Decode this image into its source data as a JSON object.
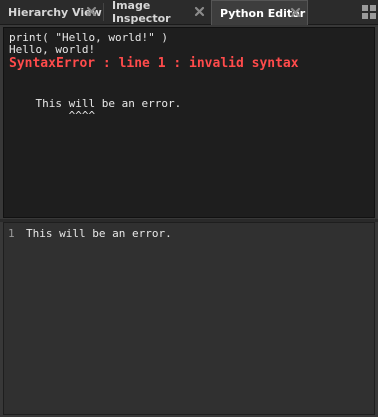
{
  "tabs": [
    {
      "label": "Hierarchy View",
      "active": false
    },
    {
      "label": "Image Inspector",
      "active": false
    },
    {
      "label": "Python Editor",
      "active": true
    }
  ],
  "output": {
    "lines": [
      "print( \"Hello, world!\" )",
      "Hello, world!"
    ],
    "error": "SyntaxError : line 1 : invalid syntax",
    "error_source": "    This will be an error.",
    "error_caret": "         ^^^^"
  },
  "editor": {
    "line_numbers": [
      "1"
    ],
    "lines": [
      "This will be an error."
    ]
  },
  "colors": {
    "error": "#ff4b4b",
    "output_bg": "#1e1e1e",
    "editor_bg": "#303030",
    "tabbar_bg": "#2b2b2b"
  },
  "icons": {
    "tab_close": "close-icon",
    "layout": "grid-layout-icon"
  }
}
